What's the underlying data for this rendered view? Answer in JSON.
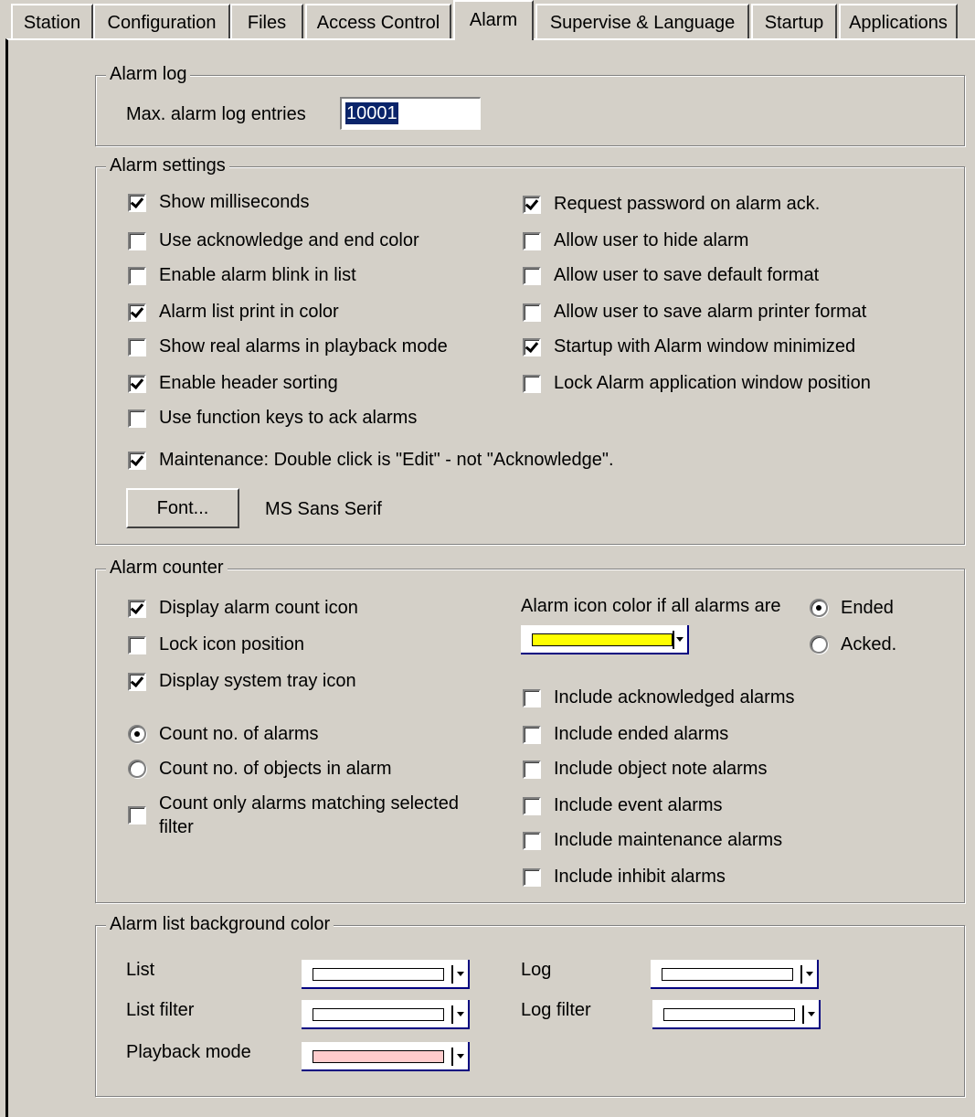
{
  "tabs": [
    "Station",
    "Configuration",
    "Files",
    "Access Control",
    "Alarm",
    "Supervise & Language",
    "Startup",
    "Applications"
  ],
  "active_tab": "Alarm",
  "alarm_log": {
    "legend": "Alarm log",
    "max_label": "Max. alarm log entries",
    "max_value": "10001"
  },
  "alarm_settings": {
    "legend": "Alarm settings",
    "left": [
      {
        "label": "Show milliseconds",
        "checked": true
      },
      {
        "label": "Use acknowledge and end color",
        "checked": false
      },
      {
        "label": "Enable alarm blink in list",
        "checked": false
      },
      {
        "label": "Alarm list print in color",
        "checked": true
      },
      {
        "label": "Show real alarms in playback mode",
        "checked": false
      },
      {
        "label": "Enable header sorting",
        "checked": true
      },
      {
        "label": "Use function keys to ack alarms",
        "checked": false
      }
    ],
    "right": [
      {
        "label": "Request password on alarm ack.",
        "checked": true
      },
      {
        "label": "Allow user to hide alarm",
        "checked": false
      },
      {
        "label": "Allow user to save default format",
        "checked": false
      },
      {
        "label": "Allow user to save alarm printer format",
        "checked": false
      },
      {
        "label": "Startup with Alarm window minimized",
        "checked": true
      },
      {
        "label": "Lock Alarm application window position",
        "checked": false
      }
    ],
    "maintenance": {
      "label": "Maintenance: Double click is \"Edit\" - not \"Acknowledge\".",
      "checked": true
    },
    "font_button": "Font...",
    "font_name": "MS Sans Serif"
  },
  "alarm_counter": {
    "legend": "Alarm counter",
    "left_checks": [
      {
        "label": "Display alarm count icon",
        "checked": true
      },
      {
        "label": "Lock icon position",
        "checked": false
      },
      {
        "label": "Display system tray icon",
        "checked": true
      }
    ],
    "count_radios": [
      {
        "label": "Count no. of alarms",
        "checked": true
      },
      {
        "label": "Count no. of objects in alarm",
        "checked": false
      }
    ],
    "filter_check": {
      "label_line1": "Count only alarms matching selected",
      "label_line2": "filter",
      "checked": false
    },
    "icon_color_label": "Alarm icon color if all alarms are",
    "icon_color": "#ffff00",
    "state_radios": [
      {
        "label": "Ended",
        "checked": true
      },
      {
        "label": "Acked.",
        "checked": false
      }
    ],
    "right_checks": [
      {
        "label": "Include acknowledged alarms",
        "checked": false
      },
      {
        "label": "Include ended alarms",
        "checked": false
      },
      {
        "label": "Include object note alarms",
        "checked": false
      },
      {
        "label": "Include event alarms",
        "checked": false
      },
      {
        "label": "Include maintenance alarms",
        "checked": false
      },
      {
        "label": "Include inhibit alarms",
        "checked": false
      }
    ]
  },
  "bg_color": {
    "legend": "Alarm list background color",
    "list": {
      "label": "List",
      "color": "#ffffff"
    },
    "list_filter": {
      "label": "List filter",
      "color": "#ffffff"
    },
    "playback": {
      "label": "Playback mode",
      "color": "#ffcccc"
    },
    "log": {
      "label": "Log",
      "color": "#ffffff"
    },
    "log_filter": {
      "label": "Log filter",
      "color": "#ffffff"
    }
  }
}
